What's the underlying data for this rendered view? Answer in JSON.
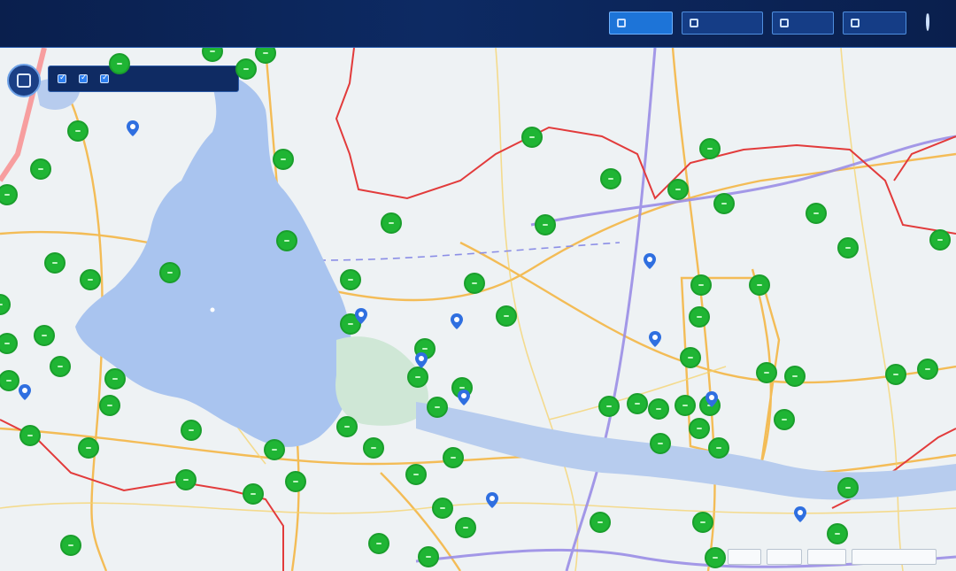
{
  "header": {
    "title": "",
    "buttons": [
      {
        "id": "btn-1",
        "label": "",
        "active": true
      },
      {
        "id": "btn-2",
        "label": "",
        "active": false
      },
      {
        "id": "btn-3",
        "label": "",
        "active": false
      },
      {
        "id": "btn-4",
        "label": "",
        "active": false
      }
    ],
    "logout_label": ""
  },
  "layer_control": {
    "icon": "layers-icon",
    "checkboxes": [
      {
        "label": "",
        "checked": true
      },
      {
        "label": "",
        "checked": true
      },
      {
        "label": "",
        "checked": true
      }
    ]
  },
  "map": {
    "colors": {
      "water": "#a9c4ef",
      "wetland": "#cfe7d6",
      "boundary_red": "#e23b3b",
      "road_orange": "#f5b33b",
      "road_yellow": "#f6d36b",
      "rail_purple": "#9a8ee6",
      "marker_green": "#1fb534",
      "pin_blue": "#2f6fe0"
    },
    "green_marker_count": 96,
    "blue_pin_count": 11
  },
  "map_controls": [
    {
      "label": ""
    },
    {
      "label": ""
    },
    {
      "label": ""
    },
    {
      "label": ""
    }
  ]
}
